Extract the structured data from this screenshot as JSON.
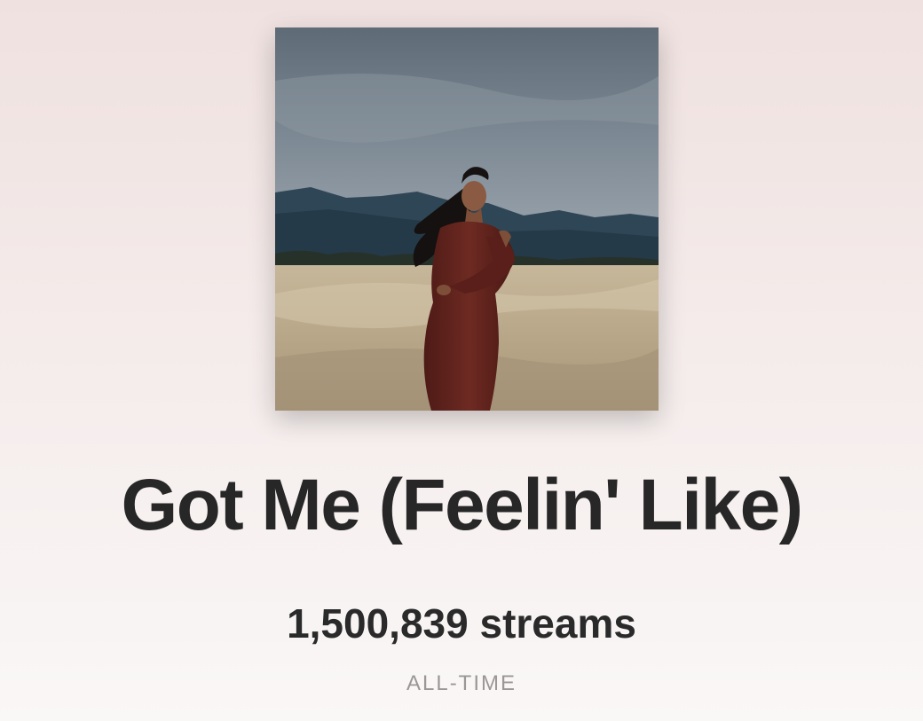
{
  "track": {
    "title": "Got Me (Feelin' Like)",
    "streams_text": "1,500,839 streams",
    "period_label": "ALL-TIME"
  },
  "cover": {
    "image_name": "album-cover-art"
  },
  "colors": {
    "background_top": "#efe1df",
    "background_bottom": "#faf7f7",
    "title_text": "#272727",
    "period_text": "#9b9797"
  }
}
